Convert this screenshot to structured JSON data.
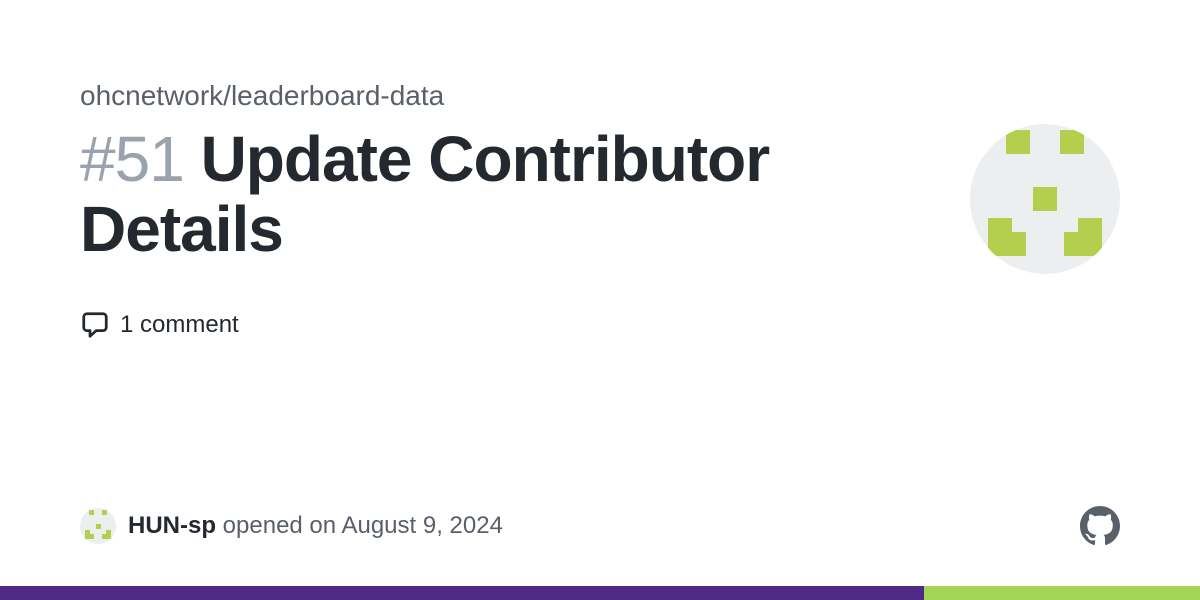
{
  "repo": {
    "path": "ohcnetwork/leaderboard-data"
  },
  "issue": {
    "number_display": "#51",
    "title": "Update Contributor Details",
    "comments_label": "1 comment"
  },
  "opened": {
    "username": "HUN-sp",
    "action": "opened on",
    "date": "August 9, 2024"
  },
  "colors": {
    "bar_purple": "#4e2a84",
    "bar_green": "#a3d455"
  }
}
